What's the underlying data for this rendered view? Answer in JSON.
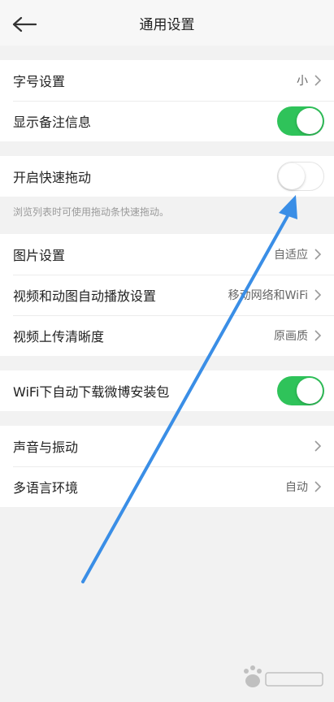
{
  "header": {
    "title": "通用设置",
    "back_icon": "back-arrow-icon"
  },
  "groups": {
    "text": {
      "font_size_label": "字号设置",
      "font_size_value": "小",
      "show_remark_label": "显示备注信息",
      "show_remark_on": true
    },
    "fast_scroll": {
      "label": "开启快速拖动",
      "on": false,
      "hint": "浏览列表时可使用拖动条快速拖动。"
    },
    "media": {
      "image_label": "图片设置",
      "image_value": "自适应",
      "autoplay_label": "视频和动图自动播放设置",
      "autoplay_value": "移动网络和WiFi",
      "upload_label": "视频上传清晰度",
      "upload_value": "原画质"
    },
    "download": {
      "label": "WiFi下自动下载微博安装包",
      "on": true
    },
    "misc": {
      "sound_label": "声音与振动",
      "language_label": "多语言环境",
      "language_value": "自动"
    }
  },
  "colors": {
    "toggle_on": "#2fc35a",
    "annotation_arrow": "#3a8ee6"
  }
}
